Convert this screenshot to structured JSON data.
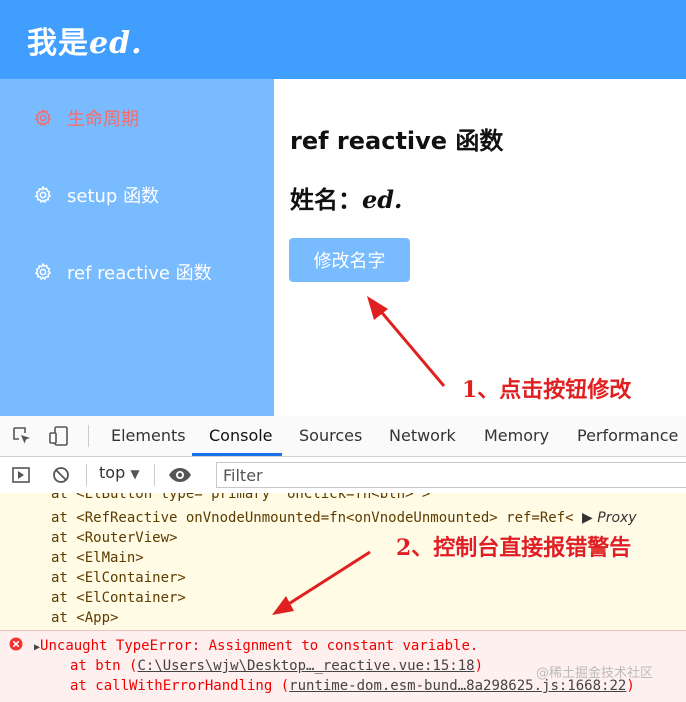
{
  "header": {
    "brand_text": "我是",
    "brand_italic": "ed."
  },
  "sidebar": {
    "items": [
      {
        "label": "生命周期"
      },
      {
        "label": "setup 函数"
      },
      {
        "label": "ref reactive 函数"
      }
    ]
  },
  "main": {
    "title": "ref reactive 函数",
    "name_label": "姓名：",
    "name_value": "ed.",
    "button_label": "修改名字"
  },
  "annotations": {
    "step1": "1、点击按钮修改",
    "step2": "2、控制台直接报错警告"
  },
  "devtools": {
    "tabs": [
      "Elements",
      "Console",
      "Sources",
      "Network",
      "Memory",
      "Performance"
    ],
    "context": "top",
    "filter_placeholder": "Filter",
    "warnings": [
      "at <ElButton type=\"primary\" onClick=fn<btn> >",
      "at <RefReactive onVnodeUnmounted=fn<onVnodeUnmounted> ref=Ref<",
      "at <RouterView>",
      "at <ElMain>",
      "at <ElContainer>",
      "at <ElContainer>",
      "at <App>"
    ],
    "proxy": "Proxy",
    "error": {
      "message": "Uncaught TypeError: Assignment to constant variable.",
      "stack1_prefix": "at btn (",
      "stack1_link": "C:\\Users\\wjw\\Desktop…_reactive.vue:15:18",
      "stack1_suffix": ")",
      "stack2_prefix": "at callWithErrorHandling (",
      "stack2_link": "runtime-dom.esm-bund…8a298625.js:1668:22",
      "stack2_suffix": ")"
    }
  },
  "watermark": "@稀土掘金技术社区",
  "colors": {
    "primary": "#409eff",
    "sidebar": "#79bbff",
    "active": "#f56c6c",
    "annotation": "#e02020"
  }
}
